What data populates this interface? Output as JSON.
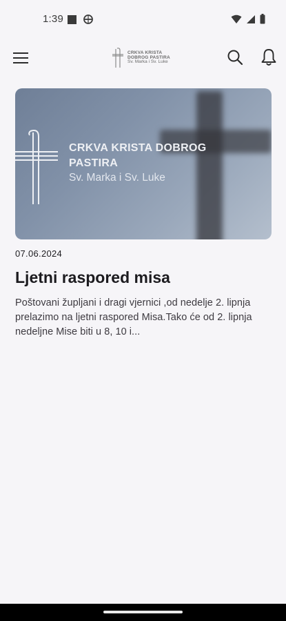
{
  "status_bar": {
    "time": "1:39",
    "left_icons": [
      "stop-square-icon",
      "vpn-circle-icon"
    ],
    "right_icons": [
      "wifi-icon",
      "cell-signal-icon",
      "battery-icon"
    ]
  },
  "app_bar": {
    "menu_icon": "hamburger-menu-icon",
    "logo": {
      "line1": "CRKVA KRISTA",
      "line2": "DOBROG PASTIRA",
      "line3": "Sv. Marka i Sv. Luke"
    },
    "actions": [
      "search-icon",
      "bell-icon"
    ]
  },
  "posts": [
    {
      "banner": {
        "line1": "CRKVA KRISTA DOBROG",
        "line2": "PASTIRA",
        "line3": "Sv. Marka i Sv. Luke"
      },
      "date": "07.06.2024",
      "title": "Ljetni raspored misa",
      "excerpt": "Poštovani župljani i dragi vjernici ,od nedelje 2. lipnja prelazimo na ljetni raspored Misa.Tako će od 2. lipnja nedeljne Mise biti u 8, 10 i..."
    }
  ],
  "colors": {
    "background": "#f6f5f8",
    "text": "#1c1b1f",
    "banner_gradient_start": "#6f7f97",
    "banner_gradient_end": "#b4bfcd"
  }
}
